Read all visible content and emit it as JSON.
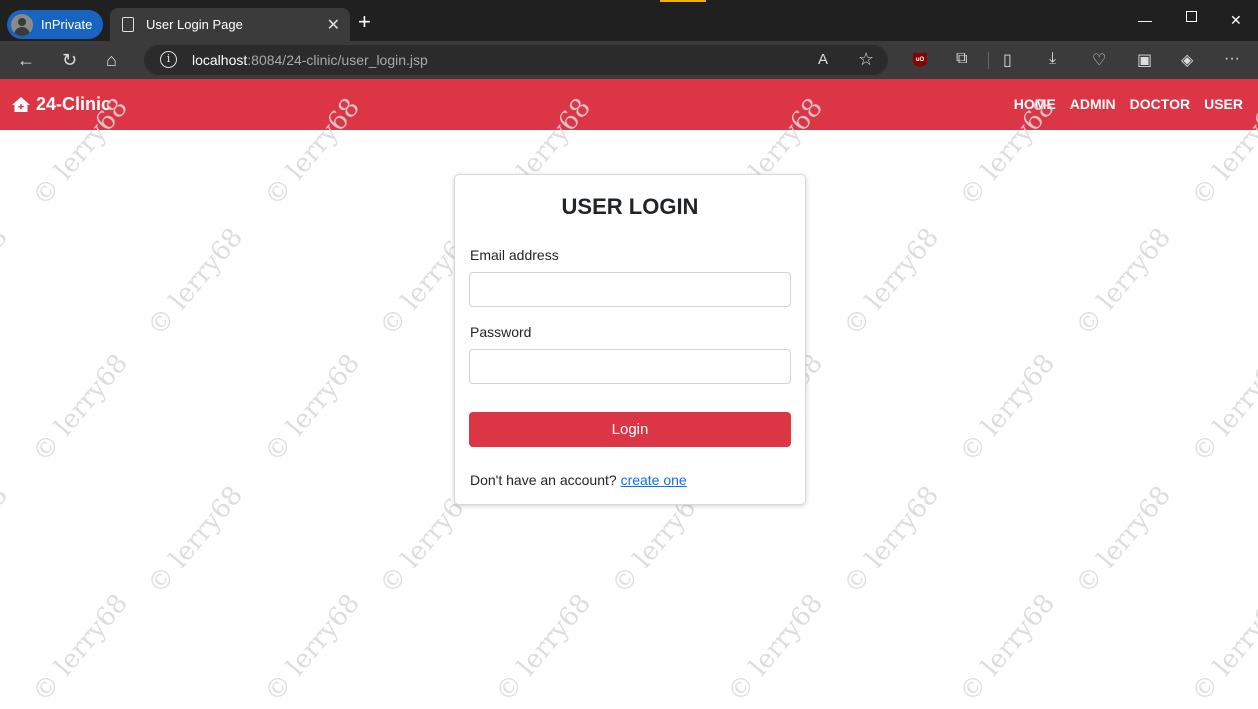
{
  "browser": {
    "profile_label": "InPrivate",
    "tab_title": "User Login Page",
    "url_host": "localhost",
    "url_path": ":8084/24-clinic/user_login.jsp"
  },
  "navbar": {
    "brand": "24-Clinic",
    "links": [
      "HOME",
      "ADMIN",
      "DOCTOR",
      "USER"
    ]
  },
  "login": {
    "title": "USER LOGIN",
    "email_label": "Email address",
    "email_value": "",
    "password_label": "Password",
    "password_value": "",
    "button_label": "Login",
    "signup_prompt": "Don't have an account?",
    "signup_link": "create one"
  },
  "watermark": "© lerry68",
  "colors": {
    "accent": "#dc3545",
    "chrome_dark": "#202020",
    "chrome_toolbar": "#3b3b3b",
    "inprivate": "#1765c0",
    "link": "#0d6efd"
  }
}
